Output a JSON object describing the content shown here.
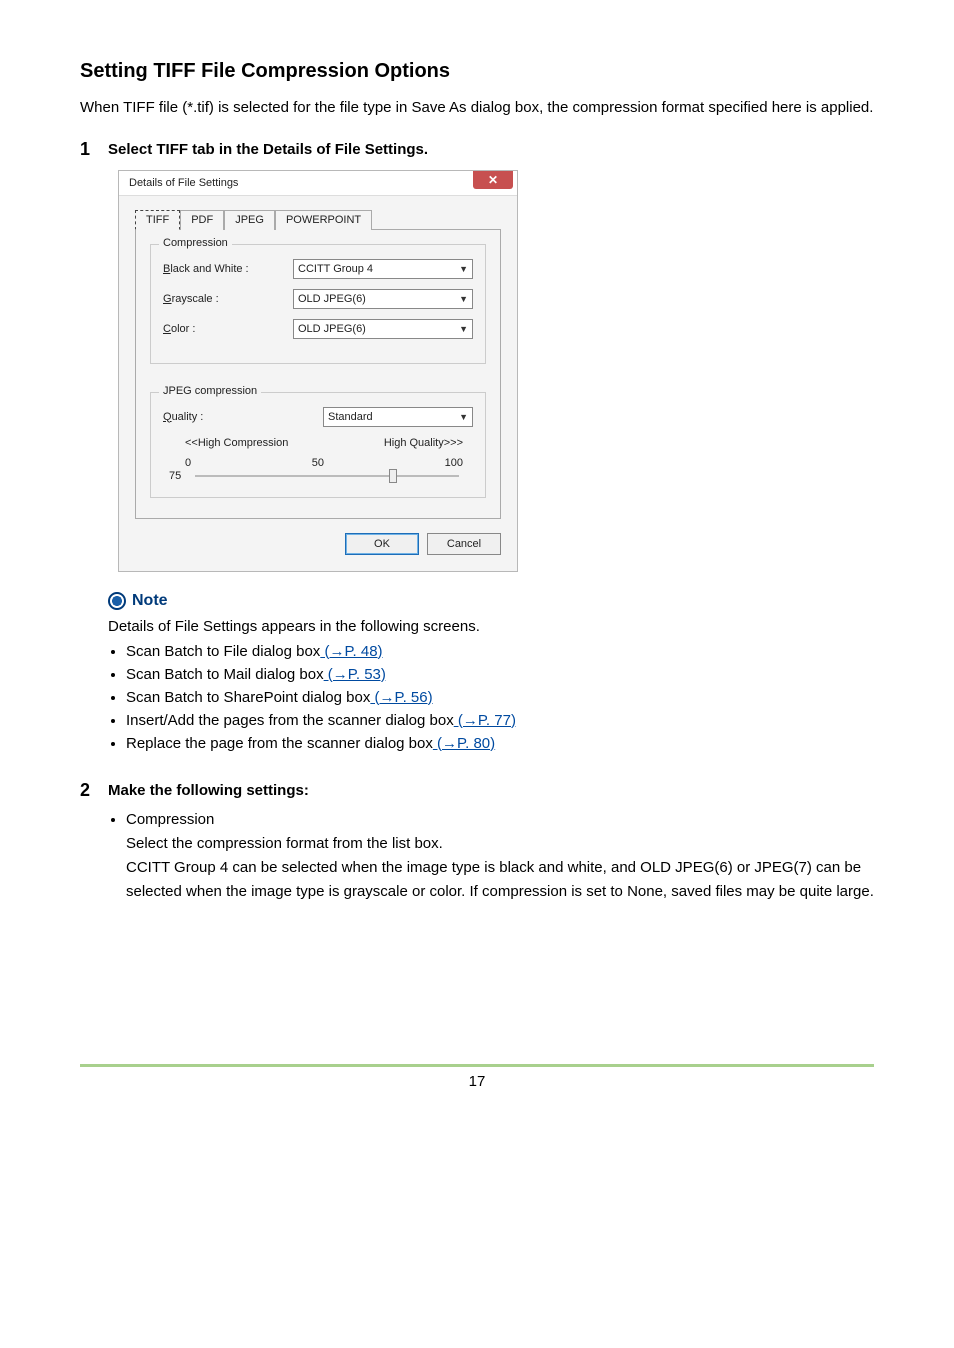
{
  "heading": "Setting TIFF File Compression Options",
  "intro": "When TIFF file (*.tif) is selected for the file type in Save As dialog box, the compression format specified here is applied.",
  "step1": {
    "num": "1",
    "title": "Select TIFF tab in the Details of File Settings."
  },
  "dialog": {
    "title": "Details of File Settings",
    "close": "✕",
    "tabs": {
      "tiff": "TIFF",
      "pdf": "PDF",
      "jpeg": "JPEG",
      "powerpoint": "POWERPOINT"
    },
    "group_compression": "Compression",
    "bw_label_pre": "B",
    "bw_label_rest": "lack and White :",
    "gs_label_pre": "G",
    "gs_label_rest": "rayscale :",
    "color_label_pre": "C",
    "color_label_rest": "olor :",
    "bw_value": "CCITT Group 4",
    "gs_value": "OLD JPEG(6)",
    "color_value": "OLD JPEG(6)",
    "group_jpeg": "JPEG compression",
    "quality_label_pre": "Q",
    "quality_label_rest": "uality :",
    "quality_value": "Standard",
    "left_hint": "<<High Compression",
    "right_hint": "High Quality>>>",
    "scale_0": "0",
    "scale_50": "50",
    "scale_100": "100",
    "slider_val": "75",
    "ok": "OK",
    "cancel": "Cancel"
  },
  "note": {
    "label": "Note",
    "text": "Details of File Settings appears in the following screens.",
    "items": [
      {
        "text": "Scan Batch to File dialog box",
        "link": " (→P. 48)"
      },
      {
        "text": "Scan Batch to Mail dialog box",
        "link": " (→P. 53)"
      },
      {
        "text": "Scan Batch to SharePoint dialog box",
        "link": " (→P. 56)"
      },
      {
        "text": "Insert/Add the pages from the scanner dialog box",
        "link": " (→P. 77)"
      },
      {
        "text": "Replace the page from the scanner dialog box",
        "link": " (→P. 80)"
      }
    ]
  },
  "step2": {
    "num": "2",
    "title": "Make the following settings:",
    "bullet": "Compression",
    "line1": "Select the compression format from the list box.",
    "line2": "CCITT Group 4 can be selected when the image type is black and white, and OLD JPEG(6) or JPEG(7) can be selected when the image type is grayscale or color. If compression is set to None, saved files may be quite large."
  },
  "page_number": "17"
}
